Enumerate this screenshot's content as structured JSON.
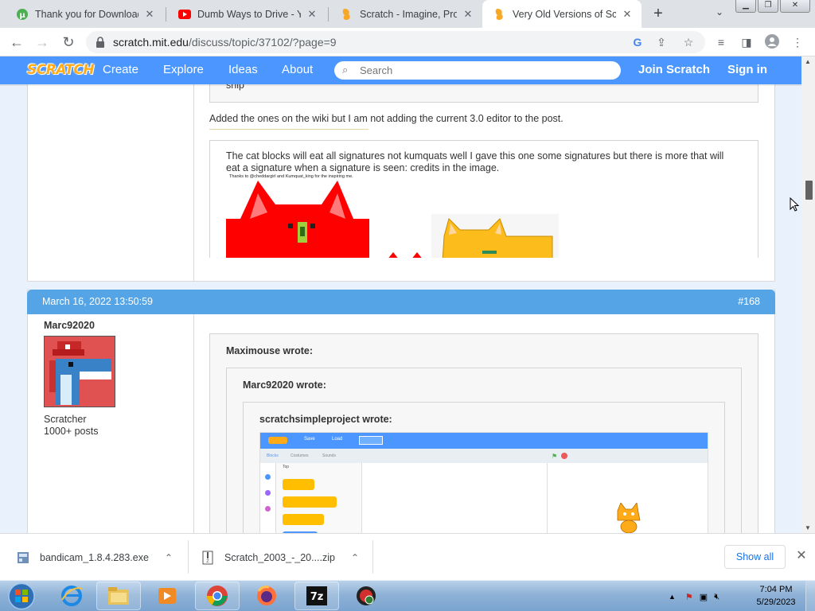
{
  "browser": {
    "tabs": [
      {
        "title": "Thank you for Downloadi",
        "icon": "utorrent-icon"
      },
      {
        "title": "Dumb Ways to Drive - Yo",
        "icon": "youtube-icon"
      },
      {
        "title": "Scratch - Imagine, Progra",
        "icon": "scratch-icon"
      },
      {
        "title": "Very Old Versions of Scra",
        "icon": "scratch-icon",
        "active": true
      }
    ],
    "new_tab": "+",
    "tab_menu": "⌄",
    "url_host": "scratch.mit.edu",
    "url_path": "/discuss/topic/37102/?page=9"
  },
  "scratch_nav": {
    "logo": "SCRATCH",
    "links": [
      "Create",
      "Explore",
      "Ideas",
      "About"
    ],
    "search_placeholder": "Search",
    "join": "Join Scratch",
    "sign_in": "Sign in"
  },
  "post1": {
    "quote_tail": "ship",
    "body": "Added the ones on the wiki but I am not adding the current 3.0 editor to the post.",
    "signature_text": "The cat blocks will eat all signatures not kumquats well I gave this one some signatures but there is more that will eat a signature when a signature is seen: credits in the image.",
    "image_caption": "Thanks to @cheddargirl and Kumquat_king for the inspiring me."
  },
  "post2": {
    "date": "March 16, 2022 13:50:59",
    "number": "#168",
    "author": "Marc92020",
    "role": "Scratcher",
    "posts": "1000+ posts",
    "quote1_label": "Maximouse wrote:",
    "quote2_label": "Marc92020 wrote:",
    "quote3_label": "scratchsimpleproject wrote:",
    "editor_menu": [
      "Save",
      "Load"
    ],
    "editor_tabs": [
      "Blocks",
      "Costumes",
      "Sounds"
    ],
    "editor_category": "Top"
  },
  "downloads": {
    "items": [
      {
        "name": "bandicam_1.8.4.283.exe"
      },
      {
        "name": "Scratch_2003_-_20....zip"
      }
    ],
    "show_all": "Show all"
  },
  "taskbar": {
    "time": "7:04 PM",
    "date": "5/29/2023"
  }
}
